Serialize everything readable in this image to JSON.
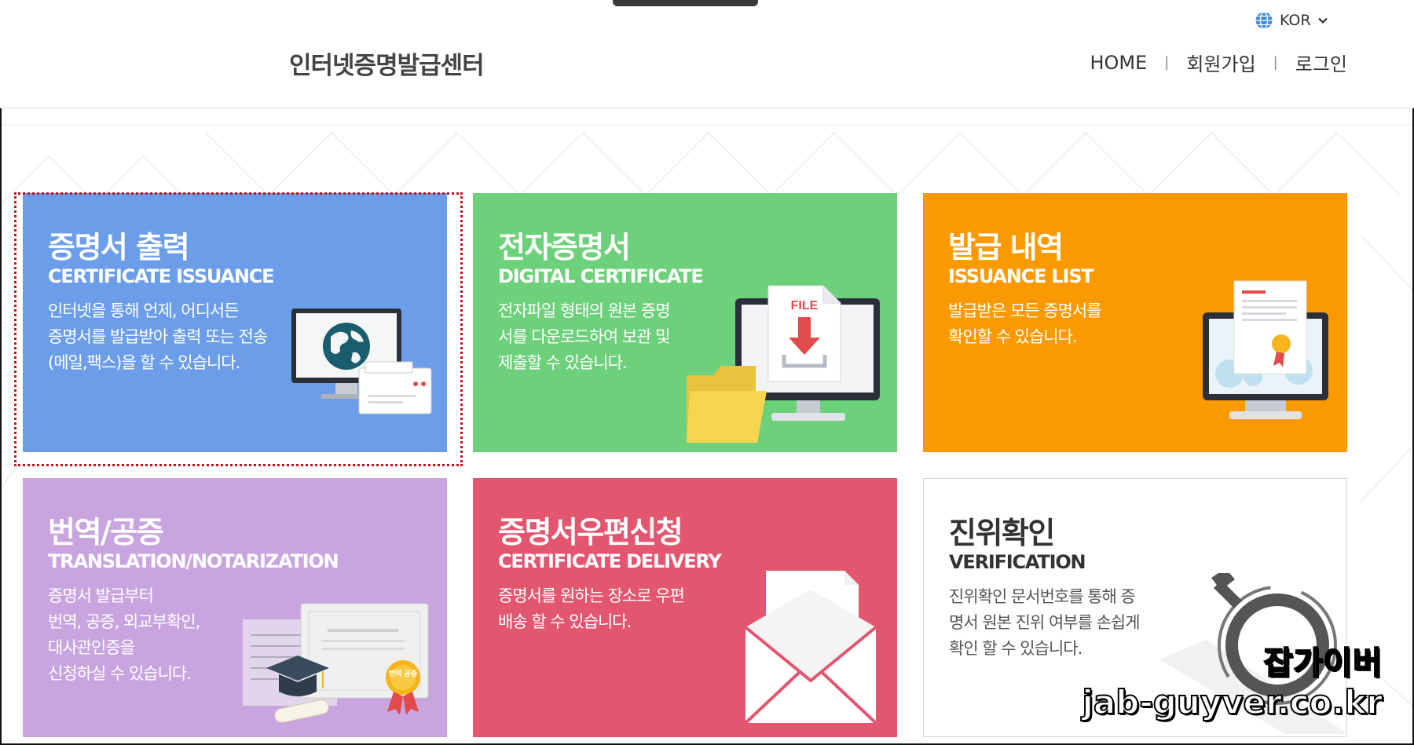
{
  "header": {
    "site_title": "인터넷증명발급센터",
    "language": "KOR",
    "nav": {
      "home": "HOME",
      "signup": "회원가입",
      "login": "로그인",
      "separator": "|"
    }
  },
  "cards": [
    {
      "title": "증명서 출력",
      "subtitle": "CERTIFICATE ISSUANCE",
      "desc": [
        "인터넷을 통해 언제, 어디서든",
        "증명서를 발급받아 출력 또는 전송",
        "(메일,팩스)을 할 수 있습니다."
      ],
      "color": "#6b9de8",
      "icon": "computer-globe-icon"
    },
    {
      "title": "전자증명서",
      "subtitle": "DIGITAL CERTIFICATE",
      "desc": [
        "전자파일 형태의 원본 증명",
        "서를 다운로드하여 보관 및",
        "제출할 수 있습니다."
      ],
      "color": "#6dd07a",
      "icon": "file-download-icon",
      "icon_text": "FILE"
    },
    {
      "title": "발급 내역",
      "subtitle": "ISSUANCE LIST",
      "desc": [
        "발급받은 모든 증명서를",
        "확인할 수 있습니다."
      ],
      "color": "#fb9a00",
      "icon": "certificate-monitor-icon"
    },
    {
      "title": "번역/공증",
      "subtitle": "TRANSLATION/NOTARIZATION",
      "desc": [
        "증명서 발급부터",
        "번역, 공증, 외교부확인,",
        "대사관인증을",
        "신청하실 수 있습니다."
      ],
      "color": "#c9a5e0",
      "icon": "diploma-icon",
      "icon_text": "번역 공증"
    },
    {
      "title": "증명서우편신청",
      "subtitle": "CERTIFICATE DELIVERY",
      "desc": [
        "증명서를 원하는 장소로 우편",
        "배송 할 수 있습니다."
      ],
      "color": "#e2566f",
      "icon": "envelope-icon"
    },
    {
      "title": "진위확인",
      "subtitle": "VERIFICATION",
      "desc": [
        "진위확인 문서번호를 통해 증",
        "명서 원본 진위 여부를 손쉽게",
        "확인 할 수 있습니다."
      ],
      "color": "#ffffff",
      "icon": "magnifier-icon"
    }
  ],
  "watermark": {
    "name": "잡가이버",
    "url": "jab-guyver.co.kr"
  }
}
